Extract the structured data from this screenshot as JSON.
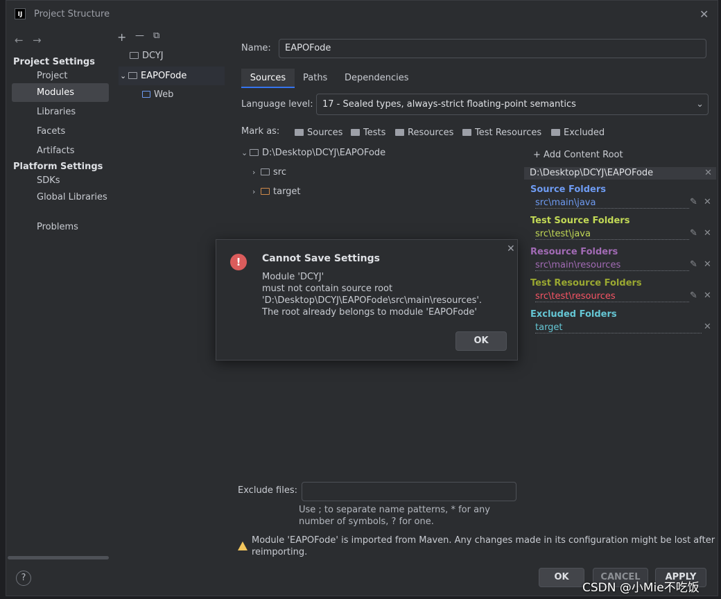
{
  "window": {
    "title": "Project Structure",
    "app_icon": "IJ"
  },
  "left_nav": {
    "project_settings_header": "Project Settings",
    "project_items": [
      "Project",
      "Modules",
      "Libraries",
      "Facets",
      "Artifacts"
    ],
    "platform_settings_header": "Platform Settings",
    "platform_items": [
      "SDKs",
      "Global Libraries"
    ],
    "problems": "Problems",
    "selected": "Modules"
  },
  "module_tree": {
    "toolbar": {
      "add": "+",
      "remove": "—",
      "copy": "⧉"
    },
    "items": [
      "DCYJ",
      "EAPOFode",
      "Web"
    ]
  },
  "details": {
    "name_label": "Name:",
    "name_value": "EAPOFode",
    "tabs": [
      "Sources",
      "Paths",
      "Dependencies"
    ],
    "active_tab": "Sources",
    "language_level_label": "Language level:",
    "language_level_value": "17 - Sealed types, always-strict floating-point semantics",
    "mark_as_label": "Mark as:",
    "mark_as": [
      "Sources",
      "Tests",
      "Resources",
      "Test Resources",
      "Excluded"
    ],
    "tree": {
      "root": "D:\\Desktop\\DCYJ\\EAPOFode",
      "children": [
        "src",
        "target"
      ]
    }
  },
  "content_root": {
    "add_label": "+ Add Content Root",
    "root_path": "D:\\Desktop\\DCYJ\\EAPOFode",
    "groups": [
      {
        "title": "Source Folders",
        "path": "src\\main\\java",
        "color": "#6e9bf2",
        "path_color": "#6e9bf2"
      },
      {
        "title": "Test Source Folders",
        "path": "src\\test\\java",
        "color": "#c2d956",
        "path_color": "#c2d956"
      },
      {
        "title": "Resource Folders",
        "path": "src\\main\\resources",
        "color": "#a26bb5",
        "path_color": "#a26bb5"
      },
      {
        "title": "Test Resource Folders",
        "path": "src\\test\\resources",
        "color": "#9aa831",
        "path_color": "#f75464"
      },
      {
        "title": "Excluded Folders",
        "path": "target",
        "color": "#65c6d4",
        "path_color": "#65c6d4"
      }
    ]
  },
  "exclude": {
    "label": "Exclude files:",
    "value": "",
    "hint_line1": "Use ; to separate name patterns, * for any",
    "hint_line2": "number of symbols, ? for one."
  },
  "warning": {
    "line1": "Module 'EAPOFode' is imported from Maven. Any changes made in its configuration might be lost after",
    "line2": "reimporting."
  },
  "dialog": {
    "title": "Cannot Save Settings",
    "lines": [
      "Module 'DCYJ'",
      "must not contain source root",
      "'D:\\Desktop\\DCYJ\\EAPOFode\\src\\main\\resources'.",
      "The root already belongs to module 'EAPOFode'"
    ],
    "ok": "OK"
  },
  "footer": {
    "help": "?",
    "ok": "OK",
    "cancel": "CANCEL",
    "apply": "APPLY"
  },
  "watermark": "CSDN @小Mie不吃饭"
}
